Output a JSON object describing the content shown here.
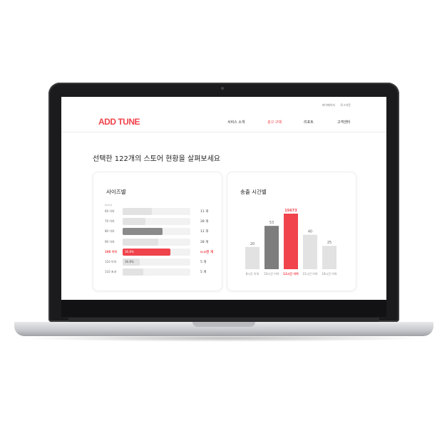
{
  "site": {
    "logo": "ADD TUNE",
    "top_links": [
      "마이페이지",
      "로그아웃"
    ],
    "menu": [
      "서비스 소개",
      "광고 구매",
      "리포트",
      "고객센터"
    ],
    "active_menu_index": 1
  },
  "headline": "선택한 122개의 스토어 현황을 살펴보세요",
  "size_card": {
    "title": "사이즈별",
    "unit": "(inch)",
    "rows": [
      {
        "label": "60 이하",
        "value": 0.43,
        "color": "#e2e2e2",
        "inner": "",
        "count": "11 개",
        "highlight": false
      },
      {
        "label": "70 이하",
        "value": 0.34,
        "color": "#e2e2e2",
        "inner": "",
        "count": "28 개",
        "highlight": false
      },
      {
        "label": "80 이하",
        "value": 0.59,
        "color": "#8a8a8a",
        "inner": "",
        "count": "11 개",
        "highlight": false
      },
      {
        "label": "90 이하",
        "value": 0.53,
        "color": "#e2e2e2",
        "inner": "",
        "count": "28 개",
        "highlight": false
      },
      {
        "label": "100 이하",
        "value": 0.7,
        "color": "#f0434b",
        "inner": "36.8%",
        "count": "n.n천 개",
        "highlight": true
      },
      {
        "label": "110 이하",
        "value": 0.25,
        "color": "#e2e2e2",
        "inner": "36.8%",
        "count": "5 개",
        "highlight": false
      },
      {
        "label": "110 초과",
        "value": 0.31,
        "color": "#e2e2e2",
        "inner": "",
        "count": "5 개",
        "highlight": false
      }
    ]
  },
  "time_card": {
    "title": "송출 시간별"
  },
  "chart_data": {
    "type": "bar",
    "categories": [
      "8시간 이하",
      "10시간 이하",
      "12시간 이하",
      "15시간 이하",
      "18시간 이하"
    ],
    "values": [
      20,
      53,
      15673,
      40,
      25
    ],
    "data_labels": [
      "20",
      "53",
      "15673",
      "40",
      "25"
    ],
    "display_heights": [
      0.4,
      0.78,
      1.0,
      0.62,
      0.42
    ],
    "highlight_index": 2,
    "colors": {
      "default": "#e2e2e2",
      "dark": "#7d7d7d",
      "highlight": "#f0434b"
    },
    "dark_index": 1
  },
  "colors": {
    "accent": "#f0434b",
    "text": "#222222",
    "muted": "#999999"
  }
}
